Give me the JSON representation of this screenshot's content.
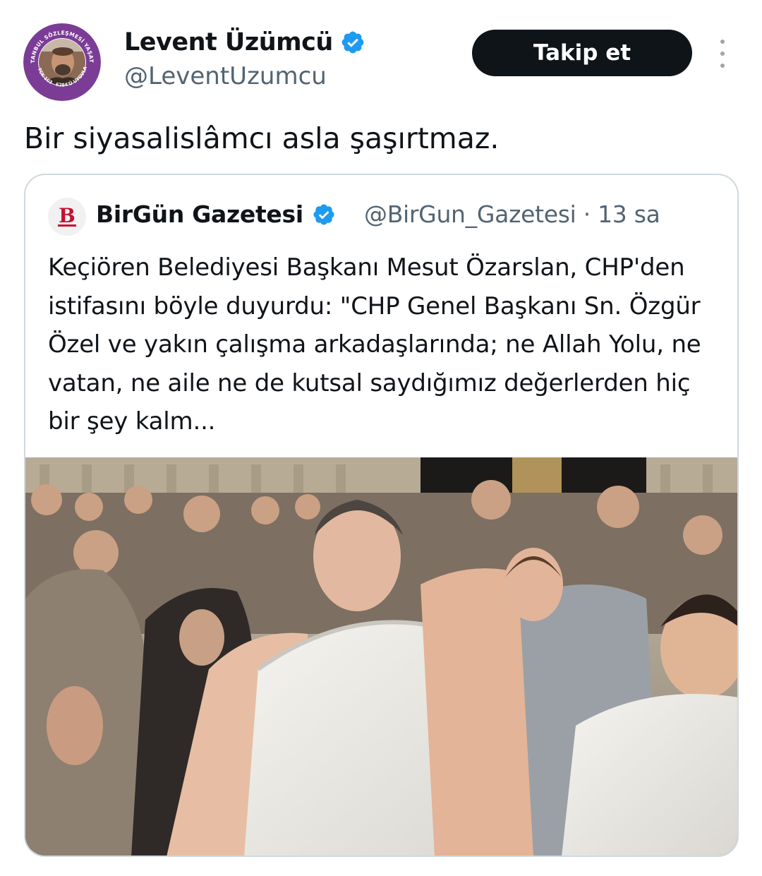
{
  "author": {
    "name": "Levent Üzümcü",
    "handle": "@LeventUzumcu",
    "avatar_ring_text": [
      "İSTANBUL SÖZLEŞMESİ YAŞATIR",
      "TCK-103",
      "6284'Ü UYGULA"
    ]
  },
  "actions": {
    "follow_label": "Takip et"
  },
  "tweet": {
    "text": "Bir siyasalislâmcı asla şaşırtmaz."
  },
  "quote": {
    "avatar_letter": "B",
    "name": "BirGün Gazetesi",
    "handle": "@BirGun_Gazetesi",
    "separator": "·",
    "time": "13 sa",
    "text": "Keçiören Belediyesi Başkanı Mesut Özarslan, CHP'den istifasını böyle duyurdu: \"CHP Genel Başkanı Sn. Özgür Özel ve yakın çalışma arkadaşlarında; ne Allah Yolu, ne vatan, ne aile ne de kutsal saydığımız değerlerden hiç bir şey kalm..."
  },
  "colors": {
    "text_primary": "#0f1419",
    "text_secondary": "#536471",
    "verified_blue": "#1d9bf0",
    "border": "#cfd9de",
    "avatar_ring": "#7b3c96",
    "birgun_red": "#c8102e"
  },
  "icons": {
    "verified": "verified-badge-icon",
    "more": "more-vertical-icon"
  }
}
